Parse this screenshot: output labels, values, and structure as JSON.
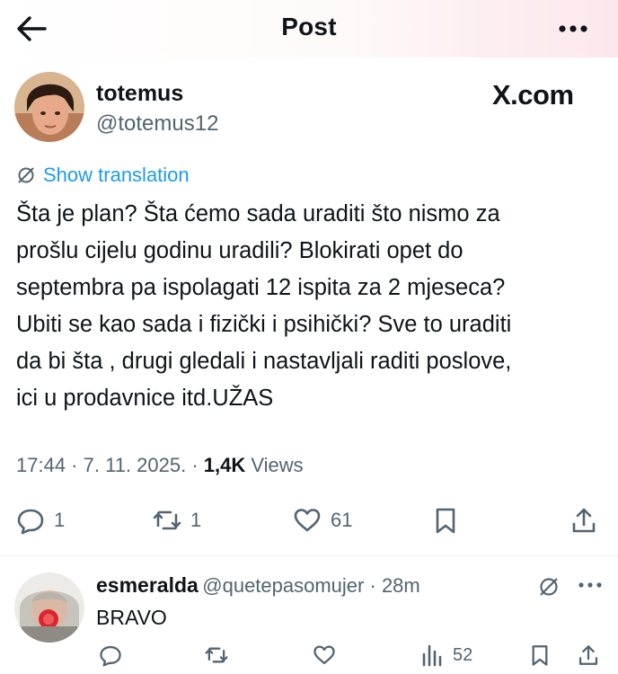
{
  "header": {
    "title": "Post"
  },
  "post": {
    "display_name": "totemus",
    "handle": "@totemus12",
    "watermark": "X.com",
    "show_translation": "Show translation",
    "text": "Šta je plan? Šta ćemo sada uraditi što nismo za\nprošlu cijelu godinu uradili? Blokirati opet do\nseptembra pa ispolagati 12 ispita za 2 mjeseca?\nUbiti se kao sada i fizički i psihički? Sve to uraditi\nda bi šta , drugi gledali i nastavljali raditi poslove,\nici u prodavnice itd.UŽAS",
    "time": "17:44",
    "date": "7. 11. 2025.",
    "views_count": "1,4K",
    "views_label": "Views",
    "replies": "1",
    "reposts": "1",
    "likes": "61"
  },
  "reply": {
    "display_name": "esmeralda",
    "handle": "@quetepasomujer",
    "time": "28m",
    "text": "BRAVO",
    "views": "52"
  },
  "colors": {
    "accent": "#1d9bf0",
    "muted": "#536471",
    "text": "#0f1419"
  }
}
